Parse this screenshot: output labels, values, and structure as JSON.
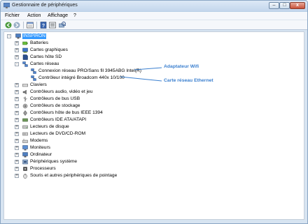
{
  "window": {
    "title": "Gestionnaire de périphériques",
    "controls": {
      "minimize": "–",
      "maximize": "□",
      "close": "x"
    }
  },
  "menu": [
    "Fichier",
    "Action",
    "Affichage",
    "?"
  ],
  "toolbar": [
    "back-icon",
    "forward-icon",
    "properties-icon",
    "help-icon",
    "scan-icon"
  ],
  "tree": {
    "root": "INSPIRON",
    "items": [
      {
        "label": "Batteries",
        "icon": "battery-icon",
        "expanded": false
      },
      {
        "label": "Cartes graphiques",
        "icon": "display-adapter-icon",
        "expanded": false
      },
      {
        "label": "Cartes hôte SD",
        "icon": "sd-host-icon",
        "expanded": false
      },
      {
        "label": "Cartes réseau",
        "icon": "network-adapter-icon",
        "expanded": true,
        "children": [
          "Connexion réseau PRO/Sans fil 3945ABG Intel(R)",
          "Contrôleur intégré Broadcom 440x 10/100"
        ]
      },
      {
        "label": "Claviers",
        "icon": "keyboard-icon",
        "expanded": false
      },
      {
        "label": "Contrôleurs audio, vidéo et jeu",
        "icon": "audio-icon",
        "expanded": false
      },
      {
        "label": "Contrôleurs de bus USB",
        "icon": "usb-icon",
        "expanded": false
      },
      {
        "label": "Contrôleurs de stockage",
        "icon": "storage-icon",
        "expanded": false
      },
      {
        "label": "Contrôleurs hôte de bus IEEE 1394",
        "icon": "ieee1394-icon",
        "expanded": false
      },
      {
        "label": "Contrôleurs IDE ATA/ATAPI",
        "icon": "ide-icon",
        "expanded": false
      },
      {
        "label": "Lecteurs de disque",
        "icon": "disk-drive-icon",
        "expanded": false
      },
      {
        "label": "Lecteurs de DVD/CD-ROM",
        "icon": "dvd-drive-icon",
        "expanded": false
      },
      {
        "label": "Modems",
        "icon": "modem-icon",
        "expanded": false
      },
      {
        "label": "Moniteurs",
        "icon": "monitor-icon",
        "expanded": false
      },
      {
        "label": "Ordinateur",
        "icon": "computer-icon",
        "expanded": false
      },
      {
        "label": "Périphériques système",
        "icon": "system-device-icon",
        "expanded": false
      },
      {
        "label": "Processeurs",
        "icon": "processor-icon",
        "expanded": false
      },
      {
        "label": "Souris et autres périphériques de pointage",
        "icon": "mouse-icon",
        "expanded": false
      }
    ]
  },
  "annotations": {
    "wifi": "Adaptateur Wifi",
    "ethernet": "Carte réseau Ethernet"
  },
  "colors": {
    "selection": "#3399ff",
    "annotation": "#3a7fcf"
  }
}
